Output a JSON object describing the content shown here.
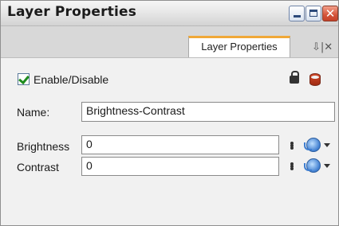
{
  "window": {
    "title": "Layer Properties",
    "close_glyph": "✕"
  },
  "tabs": [
    {
      "label": "Layer Properties"
    }
  ],
  "tab_controls": {
    "pin_close": "⇩|✕"
  },
  "enable": {
    "label": "Enable/Disable",
    "checked": true
  },
  "name": {
    "label": "Name:",
    "value": "Brightness-Contrast"
  },
  "brightness": {
    "label": "Brightness",
    "value": "0"
  },
  "contrast": {
    "label": "Contrast",
    "value": "0"
  },
  "icons": {
    "lock": "lock-icon",
    "layer": "layer-color-icon",
    "function": "function-icon"
  }
}
